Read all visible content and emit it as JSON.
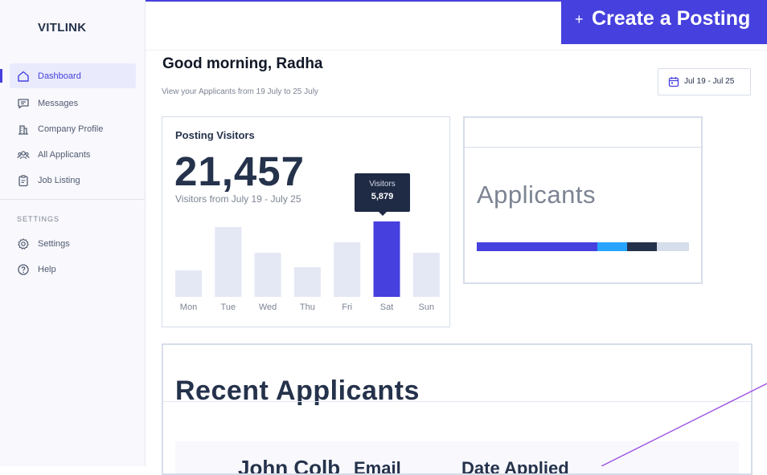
{
  "app": {
    "logo": "VITLINK"
  },
  "sidebar": {
    "items": [
      {
        "label": "Dashboard",
        "icon": "home-icon",
        "active": true
      },
      {
        "label": "Messages",
        "icon": "message-icon"
      },
      {
        "label": "Company Profile",
        "icon": "building-icon"
      },
      {
        "label": "All Applicants",
        "icon": "users-icon"
      },
      {
        "label": "Job Listing",
        "icon": "clipboard-icon"
      }
    ],
    "section_title": "SETTINGS",
    "settings_items": [
      {
        "label": "Settings",
        "icon": "gear-icon"
      },
      {
        "label": "Help",
        "icon": "help-icon"
      }
    ]
  },
  "header": {
    "create_button": {
      "plus": "+",
      "label": "Create a Posting"
    },
    "greeting": "Good morning, Radha",
    "greeting_sub": "View your Applicants from 19 July to 25 July",
    "date_range": "Jul 19 - Jul 25"
  },
  "visitors": {
    "title": "Posting Visitors",
    "total": "21,457",
    "subtitle": "Visitors from July 19 - July 25",
    "tooltip": {
      "label": "Visitors",
      "value": "5,879"
    }
  },
  "chart_data": {
    "type": "bar",
    "categories": [
      "Mon",
      "Tue",
      "Wed",
      "Thu",
      "Fri",
      "Sat",
      "Sun"
    ],
    "values": [
      33,
      87,
      55,
      37,
      68,
      94,
      55
    ],
    "highlight_index": 5,
    "ylim": [
      0,
      100
    ],
    "colors": {
      "default": "#e4e8f5",
      "highlight": "#4640de"
    }
  },
  "applicants": {
    "title": "Applicants",
    "segments": [
      {
        "value": 57,
        "color": "#4640de"
      },
      {
        "value": 14,
        "color": "#26a4ff"
      },
      {
        "value": 14,
        "color": "#25324b"
      },
      {
        "value": 15,
        "color": "#d6ddeb"
      }
    ]
  },
  "recent": {
    "title": "Recent Applicants",
    "columns": [
      "John Colb",
      "Email",
      "Date Applied"
    ]
  },
  "colors": {
    "primary": "#4640de",
    "sidebar_bg": "#f8f8fd",
    "text": "#25324b"
  }
}
